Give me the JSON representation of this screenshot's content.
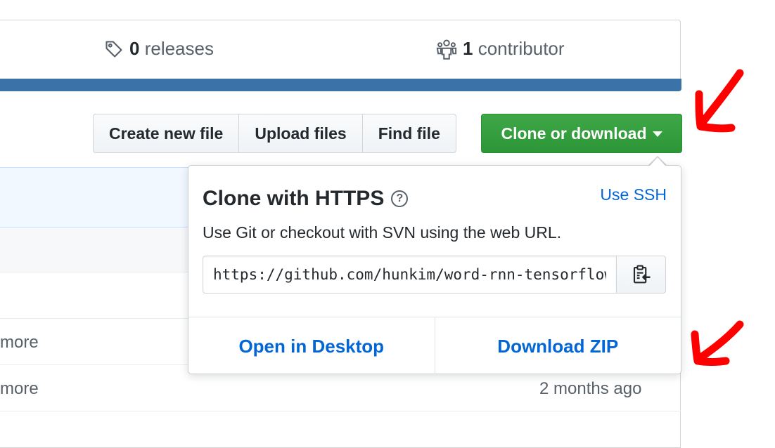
{
  "summary": {
    "releases": {
      "count": "0",
      "label": "releases"
    },
    "contributors": {
      "count": "1",
      "label": "contributor"
    }
  },
  "toolbar": {
    "create_label": "Create new file",
    "upload_label": "Upload files",
    "find_label": "Find file",
    "clone_label": "Clone or download"
  },
  "file_list": {
    "rows": [
      {
        "left_text": "more",
        "right_text": ""
      },
      {
        "left_text": "more",
        "right_text": "2 months ago"
      }
    ]
  },
  "clone_dropdown": {
    "title": "Clone with HTTPS",
    "help_glyph": "?",
    "switch_label": "Use SSH",
    "description": "Use Git or checkout with SVN using the web URL.",
    "url_value": "https://github.com/hunkim/word-rnn-tensorflow.git",
    "open_desktop_label": "Open in Desktop",
    "download_zip_label": "Download ZIP"
  },
  "colors": {
    "accent_blue": "#0366d6",
    "clone_green": "#2c9638",
    "annotation_red": "#ff0000"
  },
  "icons": [
    "tag-icon",
    "people-icon",
    "question-icon",
    "clipboard-icon",
    "caret-down-icon",
    "red-arrow-annotation"
  ]
}
